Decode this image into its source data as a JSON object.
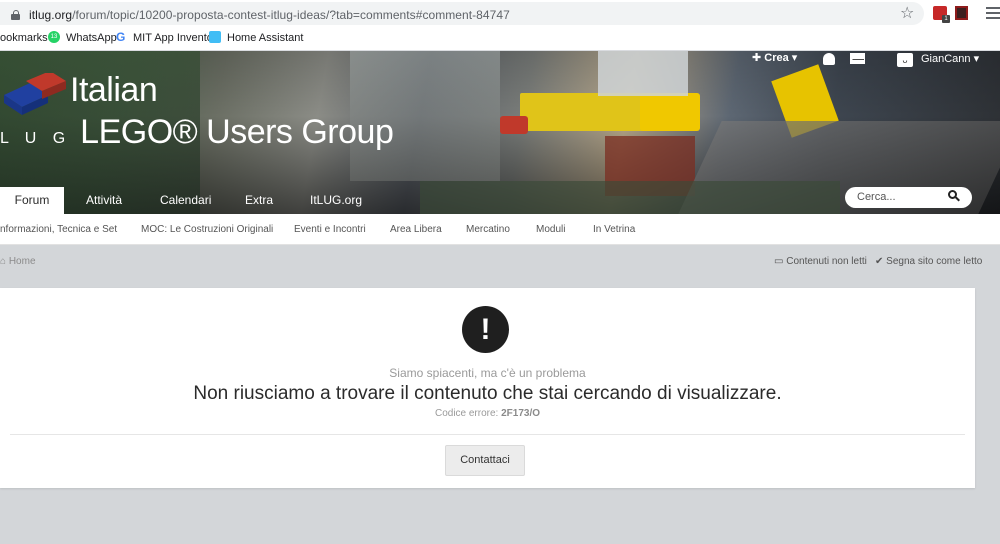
{
  "browser": {
    "url_host": "itlug.org",
    "url_path": "/forum/topic/10200-proposta-contest-itlug-ideas/?tab=comments#comment-84747",
    "bookmarks": [
      "ookmarks",
      "WhatsApp",
      "MIT App Inventor",
      "Home Assistant"
    ],
    "wa_badge": "13"
  },
  "header": {
    "logo_line1": "Italian",
    "logo_ug": "L U G",
    "logo_line2": "LEGO® Users Group",
    "create_label": "✚ Crea ▾",
    "username": "GianCann ▾"
  },
  "nav": {
    "tabs": [
      "Forum",
      "Attività",
      "Calendari",
      "Extra",
      "ItLUG.org"
    ],
    "search_placeholder": "Cerca..."
  },
  "subnav": {
    "items": [
      "nformazioni, Tecnica e Set",
      "MOC: Le Costruzioni Originali",
      "Eventi e Incontri",
      "Area Libera",
      "Mercatino",
      "Moduli",
      "In Vetrina"
    ]
  },
  "breadcrumb": {
    "home": "Home",
    "unread": "Contenuti non letti",
    "mark_read": "Segna sito come letto"
  },
  "error": {
    "sub": "Siamo spiacenti, ma c'è un problema",
    "main": "Non riusciamo a trovare il contenuto che stai cercando di visualizzare.",
    "code_label": "Codice errore:",
    "code": "2F173/O",
    "button": "Contattaci"
  },
  "colors": {
    "page_bg": "#d3d6d9",
    "banner_dark": "#2c2f33",
    "error_icon": "#1f1f1f"
  }
}
